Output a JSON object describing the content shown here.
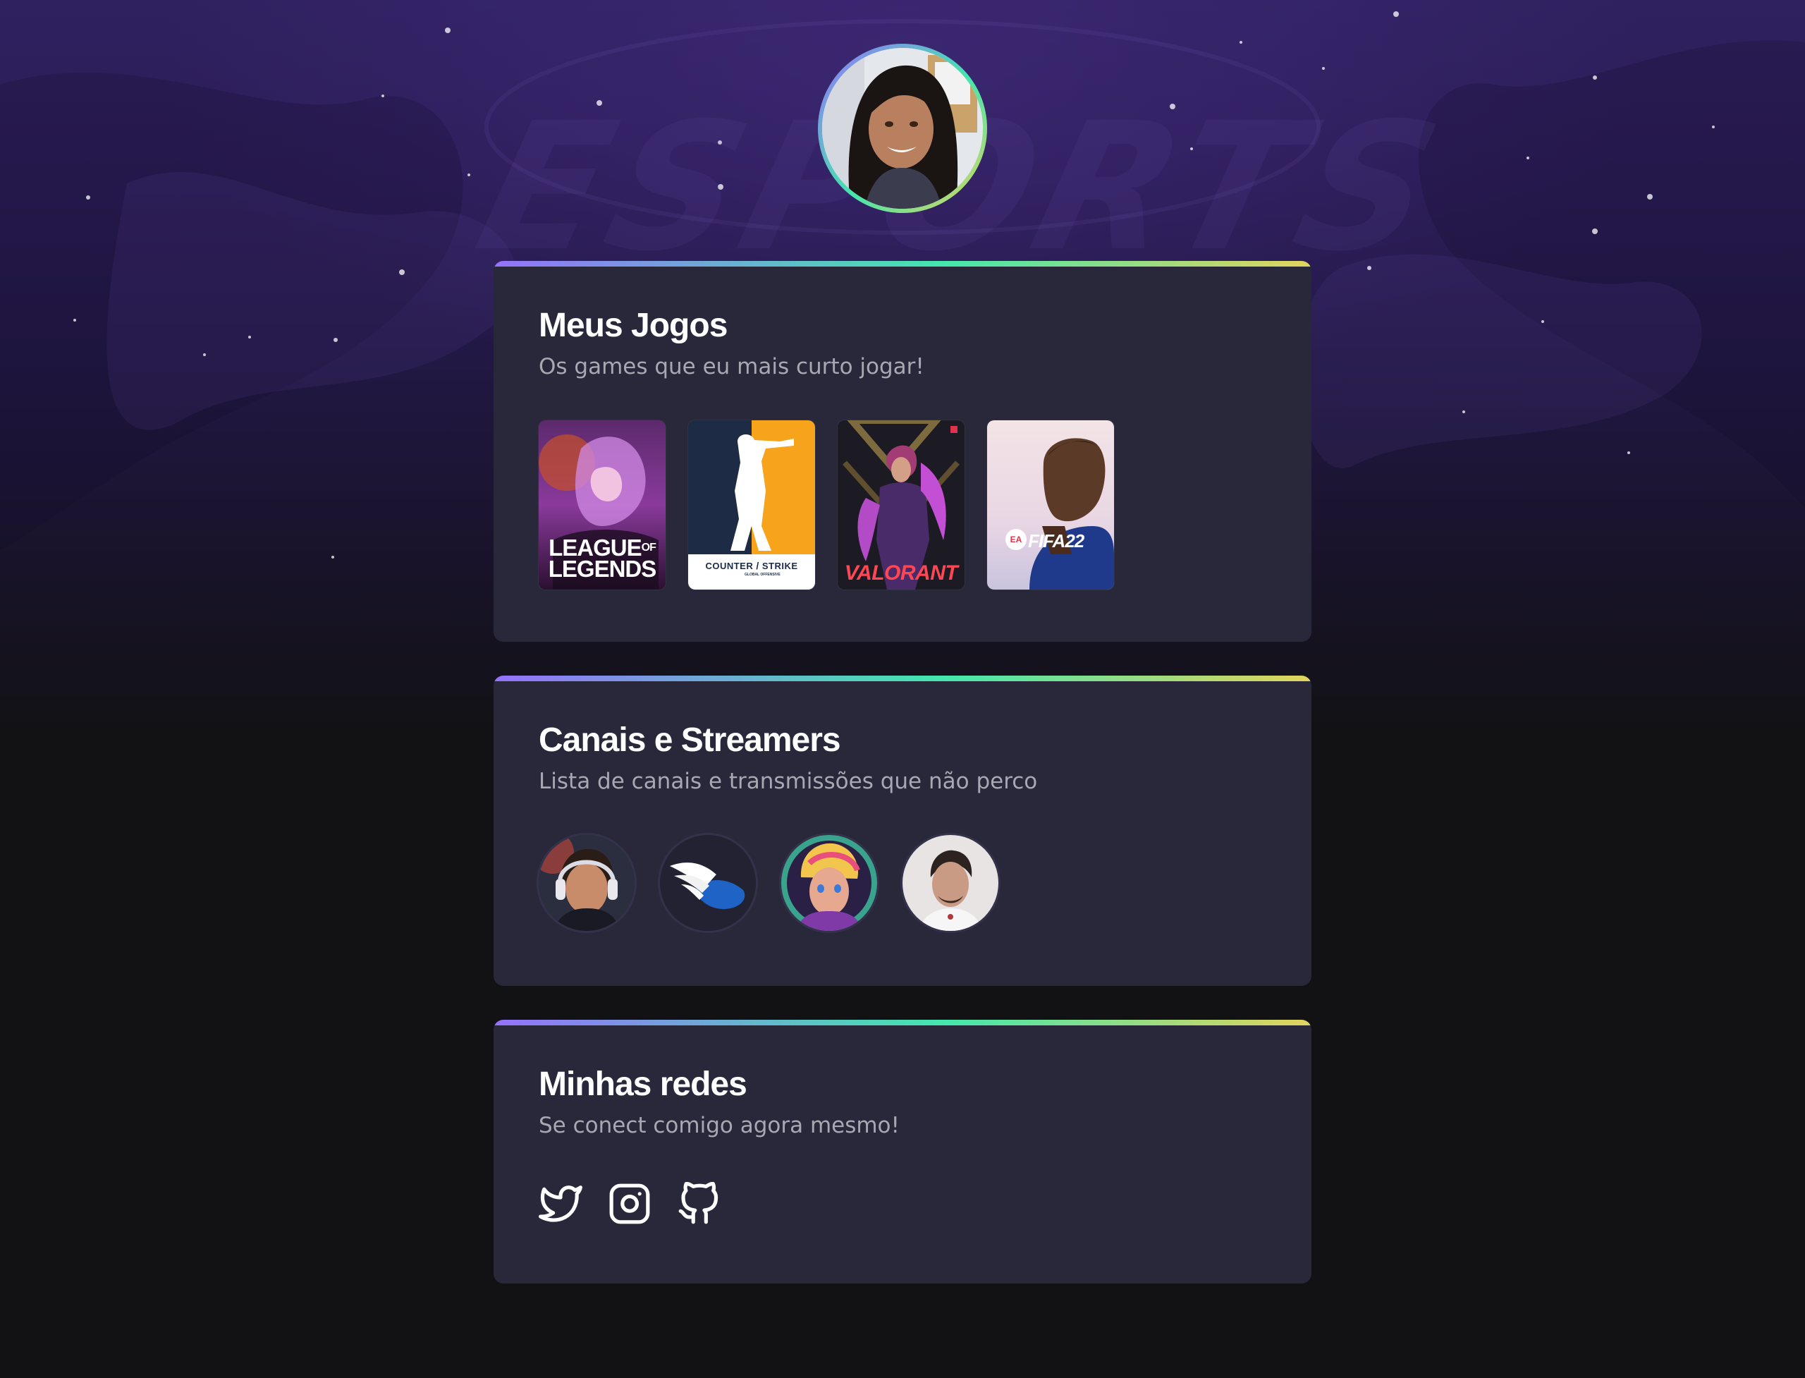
{
  "profile": {
    "avatar": "profile-photo"
  },
  "background": {
    "watermark_text": "ESPORTS"
  },
  "games_section": {
    "title": "Meus Jogos",
    "subtitle": "Os games que eu mais curto jogar!",
    "games": [
      {
        "name": "League of Legends",
        "cover_line1": "LEAGUE",
        "cover_of": "OF",
        "cover_line2": "LEGENDS"
      },
      {
        "name": "Counter Strike",
        "cover_left": "COUNTER",
        "cover_right": "STRIKE",
        "cover_small": "GLOBAL OFFENSIVE"
      },
      {
        "name": "Valorant",
        "cover_text": "VALORANT"
      },
      {
        "name": "FIFA 22",
        "cover_text": "FIFA22",
        "cover_badge": "EA"
      }
    ]
  },
  "streamers_section": {
    "title": "Canais e Streamers",
    "subtitle": "Lista de canais e transmissões que não perco",
    "streamers": [
      "streamer-1",
      "streamer-2",
      "streamer-3",
      "streamer-4"
    ]
  },
  "social_section": {
    "title": "Minhas redes",
    "subtitle": "Se conect comigo agora mesmo!",
    "icons": [
      "twitter-icon",
      "instagram-icon",
      "github-icon"
    ]
  },
  "colors": {
    "background": "#121214",
    "card": "#29273a",
    "gradient": [
      "#9572fc",
      "#43e7ad",
      "#e2d45c"
    ],
    "title": "#ffffff",
    "subtitle": "#a8a8b3"
  }
}
